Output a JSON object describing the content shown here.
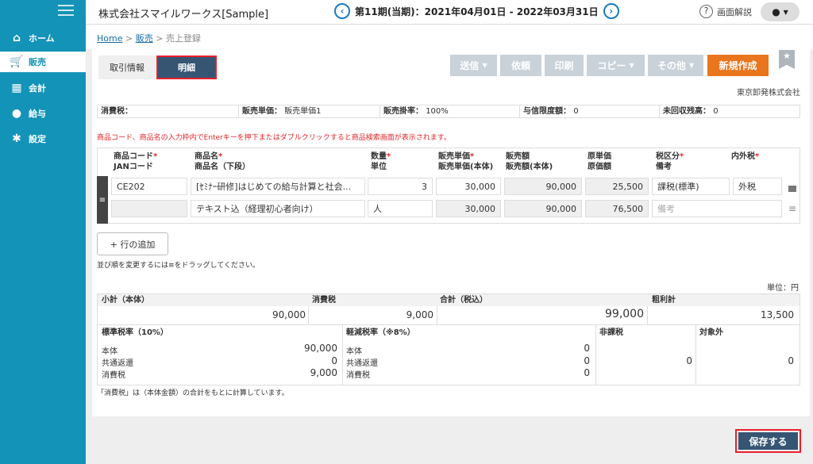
{
  "sidebar": {
    "items": [
      {
        "label": "ホーム",
        "icon": "home-icon"
      },
      {
        "label": "販売",
        "icon": "cart-icon"
      },
      {
        "label": "会計",
        "icon": "calculator-icon"
      },
      {
        "label": "給与",
        "icon": "money-bag-icon"
      },
      {
        "label": "設定",
        "icon": "gear-icon"
      }
    ]
  },
  "header": {
    "company": "株式会社スマイルワークス[Sample]",
    "period": "第11期(当期)：2021年04月01日 - 2022年03月31日",
    "help": "画面解説"
  },
  "breadcrumb": {
    "home": "Home",
    "sales": "販売",
    "current": "売上登録",
    "sep": ">"
  },
  "tabs": {
    "info": "取引情報",
    "detail": "明細"
  },
  "toolbar": {
    "send": "送信",
    "request": "依頼",
    "print": "印刷",
    "copy": "コピー",
    "other": "その他",
    "new": "新規作成"
  },
  "client": "東京卸発株式会社",
  "infobar": {
    "tax_label": "消費税：",
    "tax_value": "",
    "price_label": "販売単価：",
    "price_value": "販売単価1",
    "rate_label": "販売掛率：",
    "rate_value": "100%",
    "credit_label": "与信限度額：",
    "credit_value": "0",
    "unpaid_label": "未回収残高：",
    "unpaid_value": "0"
  },
  "warning": "商品コード、商品名の入力枠内でEnterキーを押下またはダブルクリックすると商品検索画面が表示されます。",
  "columns": {
    "code": "商品コード",
    "jan": "JANコード",
    "name": "商品名",
    "name2": "商品名（下段）",
    "qty": "数量",
    "unit": "単位",
    "price": "販売単価",
    "price_ex": "販売単価(本体)",
    "amount": "販売額",
    "amount_ex": "販売額(本体)",
    "cost": "原単価",
    "cost_amt": "原価額",
    "tax_cat": "税区分",
    "note": "備考",
    "incl": "内外税"
  },
  "row": {
    "code": "CE202",
    "jan": "",
    "name": "[ｾﾐﾅｰ研修]はじめての給与計算と社会...",
    "name2": "テキスト込（経理初心者向け）",
    "qty": "3",
    "unit": "人",
    "price": "30,000",
    "price_ex": "30,000",
    "amount": "90,000",
    "amount_ex": "90,000",
    "cost": "25,500",
    "cost_amt": "76,500",
    "tax_cat": "課税(標準)",
    "note_placeholder": "備考",
    "incl": "外税"
  },
  "add_row": "+ 行の追加",
  "drag_hint": "並び順を変更するには≡をドラッグしてください。",
  "unit_label": "単位：円",
  "totals": {
    "subtotal_label": "小計（本体）",
    "subtotal": "90,000",
    "tax_label": "消費税",
    "tax": "9,000",
    "total_label": "合計（税込）",
    "total": "99,000",
    "gross_label": "粗利計",
    "gross": "13,500",
    "std_label": "標準税率（10%）",
    "reduced_label": "軽減税率（※8%）",
    "nontax_label": "非課税",
    "exempt_label": "対象外",
    "body_label": "本体",
    "rebate_label": "共通返還",
    "ctax_label": "消費税",
    "std_body": "90,000",
    "std_rebate": "0",
    "std_tax": "9,000",
    "red_body": "0",
    "red_rebate": "0",
    "red_tax": "0",
    "nontax": "0",
    "exempt": "0"
  },
  "footnote": "「消費税」は（本体金額）の合計をもとに計算しています。",
  "save": "保存する"
}
